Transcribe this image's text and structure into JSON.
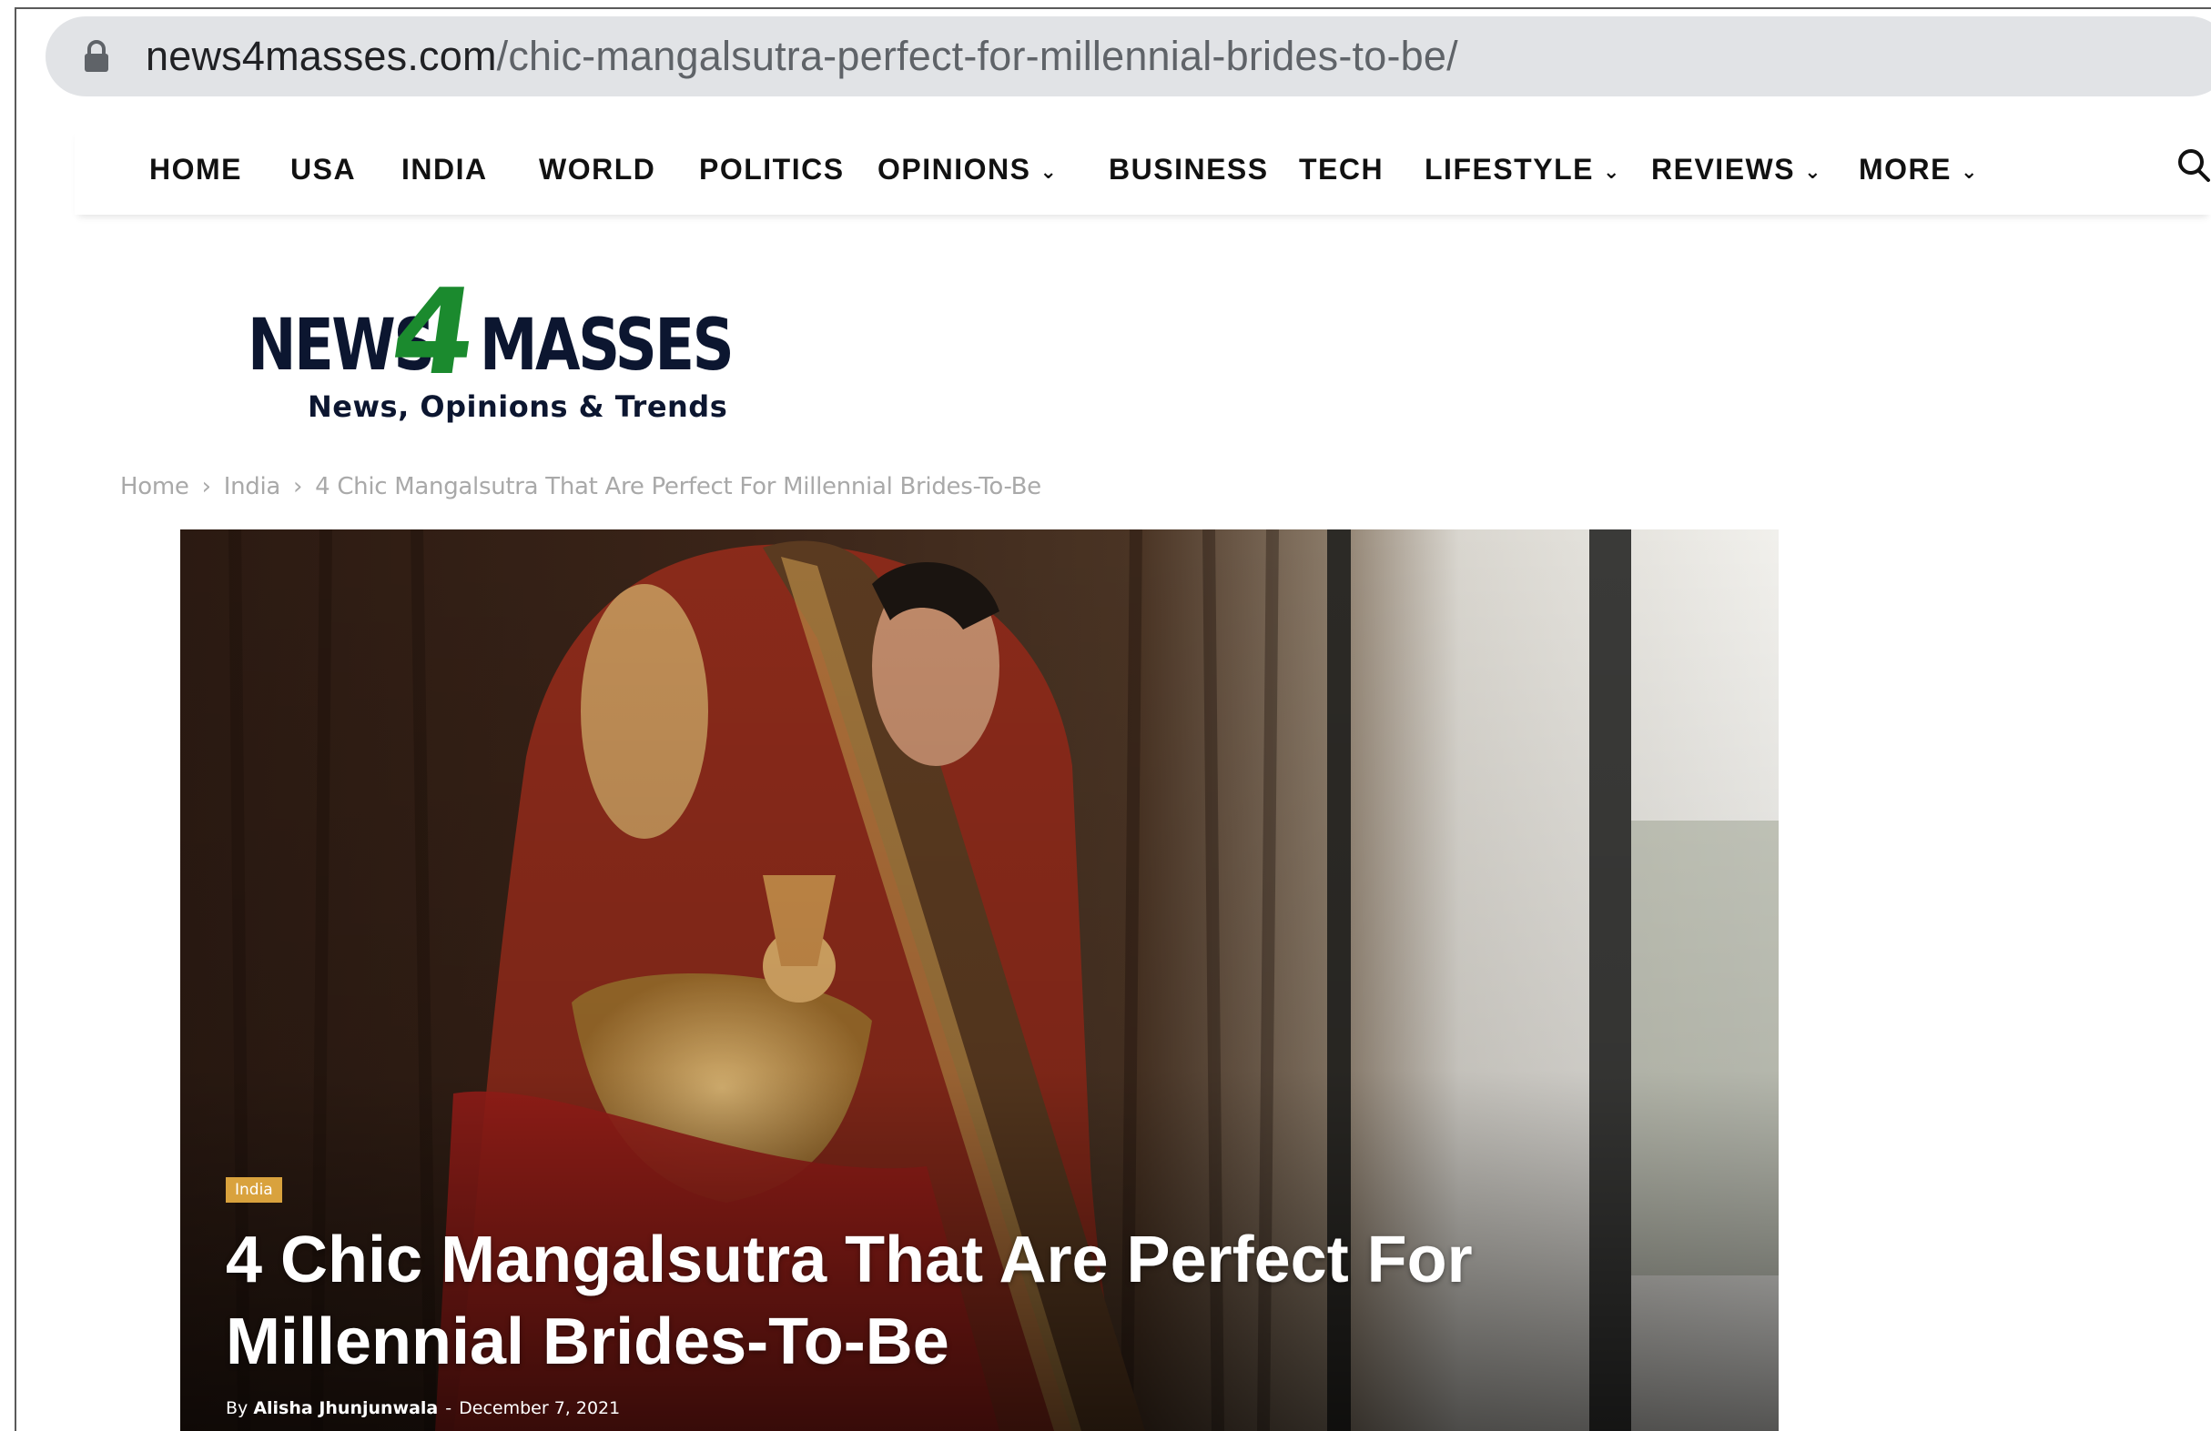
{
  "browser": {
    "url_domain": "news4masses.com",
    "url_path": "/chic-mangalsutra-perfect-for-millennial-brides-to-be/",
    "lock_icon": "lock-icon"
  },
  "nav": {
    "items": [
      {
        "label": "HOME",
        "dropdown": false
      },
      {
        "label": "USA",
        "dropdown": false
      },
      {
        "label": "INDIA",
        "dropdown": false
      },
      {
        "label": "WORLD",
        "dropdown": false
      },
      {
        "label": "POLITICS",
        "dropdown": false
      },
      {
        "label": "OPINIONS",
        "dropdown": true
      },
      {
        "label": "BUSINESS",
        "dropdown": false
      },
      {
        "label": "TECH",
        "dropdown": false
      },
      {
        "label": "LIFESTYLE",
        "dropdown": true
      },
      {
        "label": "REVIEWS",
        "dropdown": true
      },
      {
        "label": "MORE",
        "dropdown": true
      }
    ],
    "chevron": "⌄",
    "search_icon": "search-icon"
  },
  "logo": {
    "word_left": "NEWS",
    "numeral": "4",
    "word_right": "MASSES",
    "tagline": "News, Opinions & Trends"
  },
  "breadcrumb": {
    "items": [
      "Home",
      "India",
      "4 Chic Mangalsutra That Are Perfect For Millennial Brides-To-Be"
    ],
    "separator": "›"
  },
  "article": {
    "category": "India",
    "title_line1": "4 Chic Mangalsutra That Are Perfect For",
    "title_line2": "Millennial Brides-To-Be",
    "by": "By",
    "author": "Alisha Jhunjunwala",
    "separator": "-",
    "date": "December 7, 2021"
  },
  "colors": {
    "logo_navy": "#0c1630",
    "logo_green": "#1b8a2e",
    "category_badge": "#d9a23d",
    "urlbar_bg": "#e1e3e6"
  }
}
